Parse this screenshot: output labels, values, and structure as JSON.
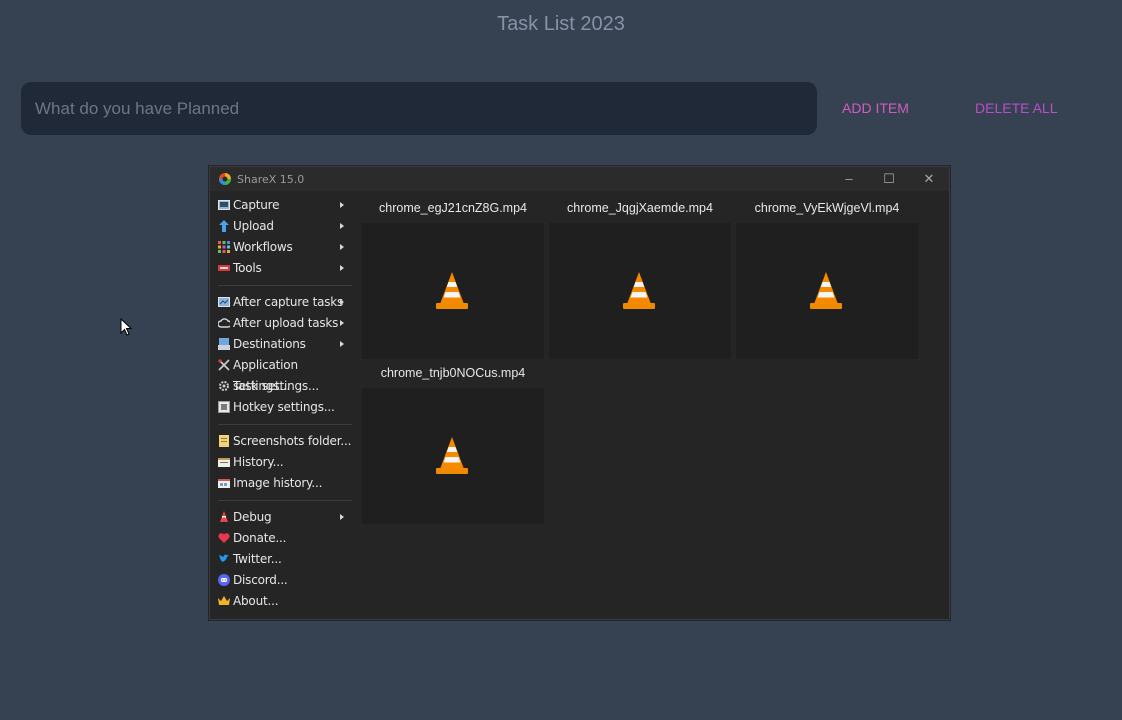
{
  "app": {
    "title": "Task List 2023",
    "input_placeholder": "What do you have Planned",
    "add_label": "ADD ITEM",
    "delete_label": "DELETE ALL"
  },
  "sharex": {
    "title": "ShareX 15.0",
    "controls": {
      "minimize": "–",
      "maximize": "☐",
      "close": "✕"
    },
    "menu": [
      {
        "label": "Capture",
        "icon": "capture-icon",
        "submenu": true
      },
      {
        "label": "Upload",
        "icon": "upload-icon",
        "submenu": true
      },
      {
        "label": "Workflows",
        "icon": "workflows-icon",
        "submenu": true
      },
      {
        "label": "Tools",
        "icon": "tools-icon",
        "submenu": true
      },
      {
        "label": "After capture tasks",
        "icon": "after-capture-icon",
        "submenu": true
      },
      {
        "label": "After upload tasks",
        "icon": "after-upload-icon",
        "submenu": true
      },
      {
        "label": "Destinations",
        "icon": "destinations-icon",
        "submenu": true
      },
      {
        "label": "Application settings...",
        "icon": "app-settings-icon",
        "submenu": false
      },
      {
        "label": "Task settings...",
        "icon": "task-settings-icon",
        "submenu": false
      },
      {
        "label": "Hotkey settings...",
        "icon": "hotkey-settings-icon",
        "submenu": false
      },
      {
        "label": "Screenshots folder...",
        "icon": "folder-icon",
        "submenu": false
      },
      {
        "label": "History...",
        "icon": "history-icon",
        "submenu": false
      },
      {
        "label": "Image history...",
        "icon": "image-history-icon",
        "submenu": false
      },
      {
        "label": "Debug",
        "icon": "debug-icon",
        "submenu": true
      },
      {
        "label": "Donate...",
        "icon": "heart-icon",
        "submenu": false
      },
      {
        "label": "Twitter...",
        "icon": "twitter-icon",
        "submenu": false
      },
      {
        "label": "Discord...",
        "icon": "discord-icon",
        "submenu": false
      },
      {
        "label": "About...",
        "icon": "crown-icon",
        "submenu": false
      }
    ],
    "files": [
      {
        "name": "chrome_egJ21cnZ8G.mp4",
        "icon": "vlc-cone-icon"
      },
      {
        "name": "chrome_JqgjXaemde.mp4",
        "icon": "vlc-cone-icon"
      },
      {
        "name": "chrome_VyEkWjgeVl.mp4",
        "icon": "vlc-cone-icon"
      },
      {
        "name": "chrome_tnjb0NOCus.mp4",
        "icon": "vlc-cone-icon"
      }
    ]
  },
  "colors": {
    "page_bg": "#364152",
    "input_bg": "#202938",
    "add_accent": "#d05ec0",
    "delete_accent": "#b64fc9",
    "window_bg": "#252526"
  }
}
